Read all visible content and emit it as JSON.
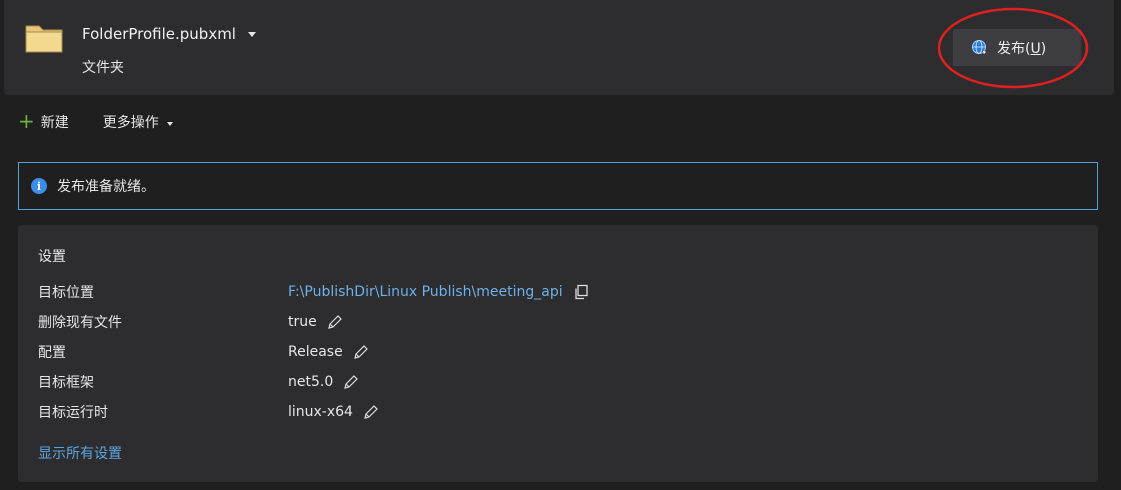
{
  "header": {
    "profile_name": "FolderProfile.pubxml",
    "profile_type": "文件夹",
    "publish_label": "发布(",
    "publish_accel": "U",
    "publish_label_end": ")"
  },
  "toolbar": {
    "new_label": "新建",
    "more_label": "更多操作"
  },
  "info": {
    "message": "发布准备就绪。"
  },
  "settings": {
    "title": "设置",
    "rows": [
      {
        "key": "目标位置",
        "value": "F:\\PublishDir\\Linux Publish\\meeting_api",
        "action": "copy-icon"
      },
      {
        "key": "删除现有文件",
        "value": "true",
        "action": "pencil-icon"
      },
      {
        "key": "配置",
        "value": "Release",
        "action": "pencil-icon"
      },
      {
        "key": "目标框架",
        "value": "net5.0",
        "action": "pencil-icon"
      },
      {
        "key": "目标运行时",
        "value": "linux-x64",
        "action": "pencil-icon"
      }
    ],
    "show_all": "显示所有设置"
  },
  "colors": {
    "accent_link": "#6fb0e8",
    "info_border": "#4aa6d8",
    "annotation": "#e02020"
  }
}
